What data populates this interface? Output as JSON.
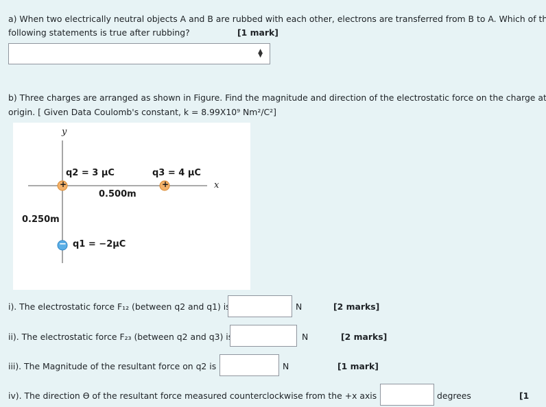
{
  "question_a": {
    "line1": "a) When two electrically neutral objects A and B are rubbed with each other, electrons are transferred from B to A. Which of the",
    "line2": "following statements is true after rubbing?",
    "marks": "[1 mark]",
    "select_value": ""
  },
  "question_b": {
    "line1": "b) Three charges are arranged as shown in Figure. Find the magnitude and direction of the electrostatic force on the charge at the",
    "line2": "origin. [ Given Data Coulomb's constant, k = 8.99X10⁹ Nm²/C²]"
  },
  "figure": {
    "y_axis": "y",
    "x_axis": "x",
    "q2_label": "q2 = 3 μC",
    "q3_label": "q3 = 4 μC",
    "q1_label": "q1 = −2μC",
    "dist_x": "0.500m",
    "dist_y": "0.250m",
    "q2_sign": "+",
    "q3_sign": "+",
    "q1_sign": "−",
    "colors": {
      "positive": "#f3b16a",
      "negative": "#5aaee6"
    }
  },
  "parts": [
    {
      "label": "i). The electrostatic force F₁₂ (between q2 and q1) is =",
      "value": "",
      "unit": "N",
      "marks": "[2 marks]"
    },
    {
      "label": "ii). The electrostatic force F₂₃ (between q2 and q3) is =",
      "value": "",
      "unit": "N",
      "marks": "[2 marks]"
    },
    {
      "label": "iii). The Magnitude of the resultant force on q2 is =",
      "value": "",
      "unit": "N",
      "marks": "[1 mark]"
    },
    {
      "label": "iv). The direction ϴ of the resultant force measured counterclockwise from the +x axis is =",
      "value": "",
      "unit": "degrees",
      "marks": "[1"
    }
  ]
}
